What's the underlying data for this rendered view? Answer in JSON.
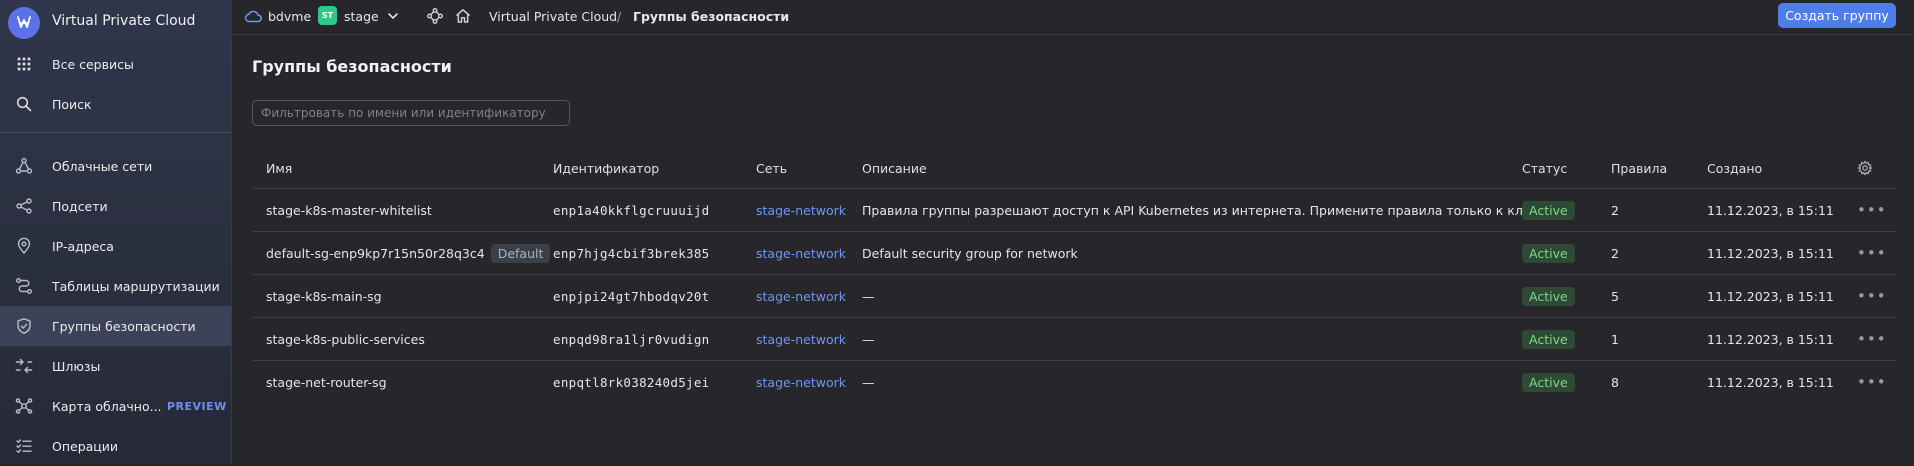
{
  "app": {
    "title": "Virtual Private Cloud"
  },
  "sidebar": {
    "top_items": [
      {
        "label": "Все сервисы",
        "icon": "grid-icon"
      },
      {
        "label": "Поиск",
        "icon": "search-icon"
      }
    ],
    "items": [
      {
        "label": "Облачные сети",
        "icon": "network-icon",
        "active": false
      },
      {
        "label": "Подсети",
        "icon": "subnets-icon",
        "active": false
      },
      {
        "label": "IP-адреса",
        "icon": "location-pin-icon",
        "active": false
      },
      {
        "label": "Таблицы маршрутизации",
        "icon": "routing-icon",
        "active": false
      },
      {
        "label": "Группы безопасности",
        "icon": "shield-icon",
        "active": true
      },
      {
        "label": "Шлюзы",
        "icon": "gateway-icon",
        "active": false
      },
      {
        "label": "Карта облачно...",
        "icon": "map-icon",
        "active": false,
        "badge": "PREVIEW"
      },
      {
        "label": "Операции",
        "icon": "operations-list-icon",
        "active": false
      }
    ]
  },
  "topbar": {
    "cloud": "bdvme",
    "folder_badge": "ST",
    "folder": "stage",
    "breadcrumb_service": "Virtual Private Cloud",
    "breadcrumb_sep": "/",
    "breadcrumb_current": "Группы безопасности",
    "create_button": "Создать группу"
  },
  "page": {
    "title": "Группы безопасности",
    "filter_placeholder": "Фильтровать по имени или идентификатору"
  },
  "table": {
    "headers": {
      "name": "Имя",
      "id": "Идентификатор",
      "network": "Сеть",
      "description": "Описание",
      "status": "Статус",
      "rules": "Правила",
      "created": "Создано"
    },
    "rows": [
      {
        "name": "stage-k8s-master-whitelist",
        "badge": "",
        "id": "enp1a40kkflgcruuuijd",
        "network": "stage-network",
        "description": "Правила группы разрешают доступ к API Kubernetes из интернета. Примените правила только к кластеру.",
        "status": "Active",
        "rules": "2",
        "created": "11.12.2023, в 15:11"
      },
      {
        "name": "default-sg-enp9kp7r15n50r28q3c4",
        "badge": "Default",
        "id": "enp7hjg4cbif3brek385",
        "network": "stage-network",
        "description": "Default security group for network",
        "status": "Active",
        "rules": "2",
        "created": "11.12.2023, в 15:11"
      },
      {
        "name": "stage-k8s-main-sg",
        "badge": "",
        "id": "enpjpi24gt7hbodqv20t",
        "network": "stage-network",
        "description": "—",
        "status": "Active",
        "rules": "5",
        "created": "11.12.2023, в 15:11"
      },
      {
        "name": "stage-k8s-public-services",
        "badge": "",
        "id": "enpqd98ra1ljr0vudign",
        "network": "stage-network",
        "description": "—",
        "status": "Active",
        "rules": "1",
        "created": "11.12.2023, в 15:11"
      },
      {
        "name": "stage-net-router-sg",
        "badge": "",
        "id": "enpqtl8rk038240d5jei",
        "network": "stage-network",
        "description": "—",
        "status": "Active",
        "rules": "8",
        "created": "11.12.2023, в 15:11"
      }
    ]
  },
  "colors": {
    "accent": "#4f7ee8",
    "active_status": "#7ed88c",
    "link": "#6e96f5"
  }
}
